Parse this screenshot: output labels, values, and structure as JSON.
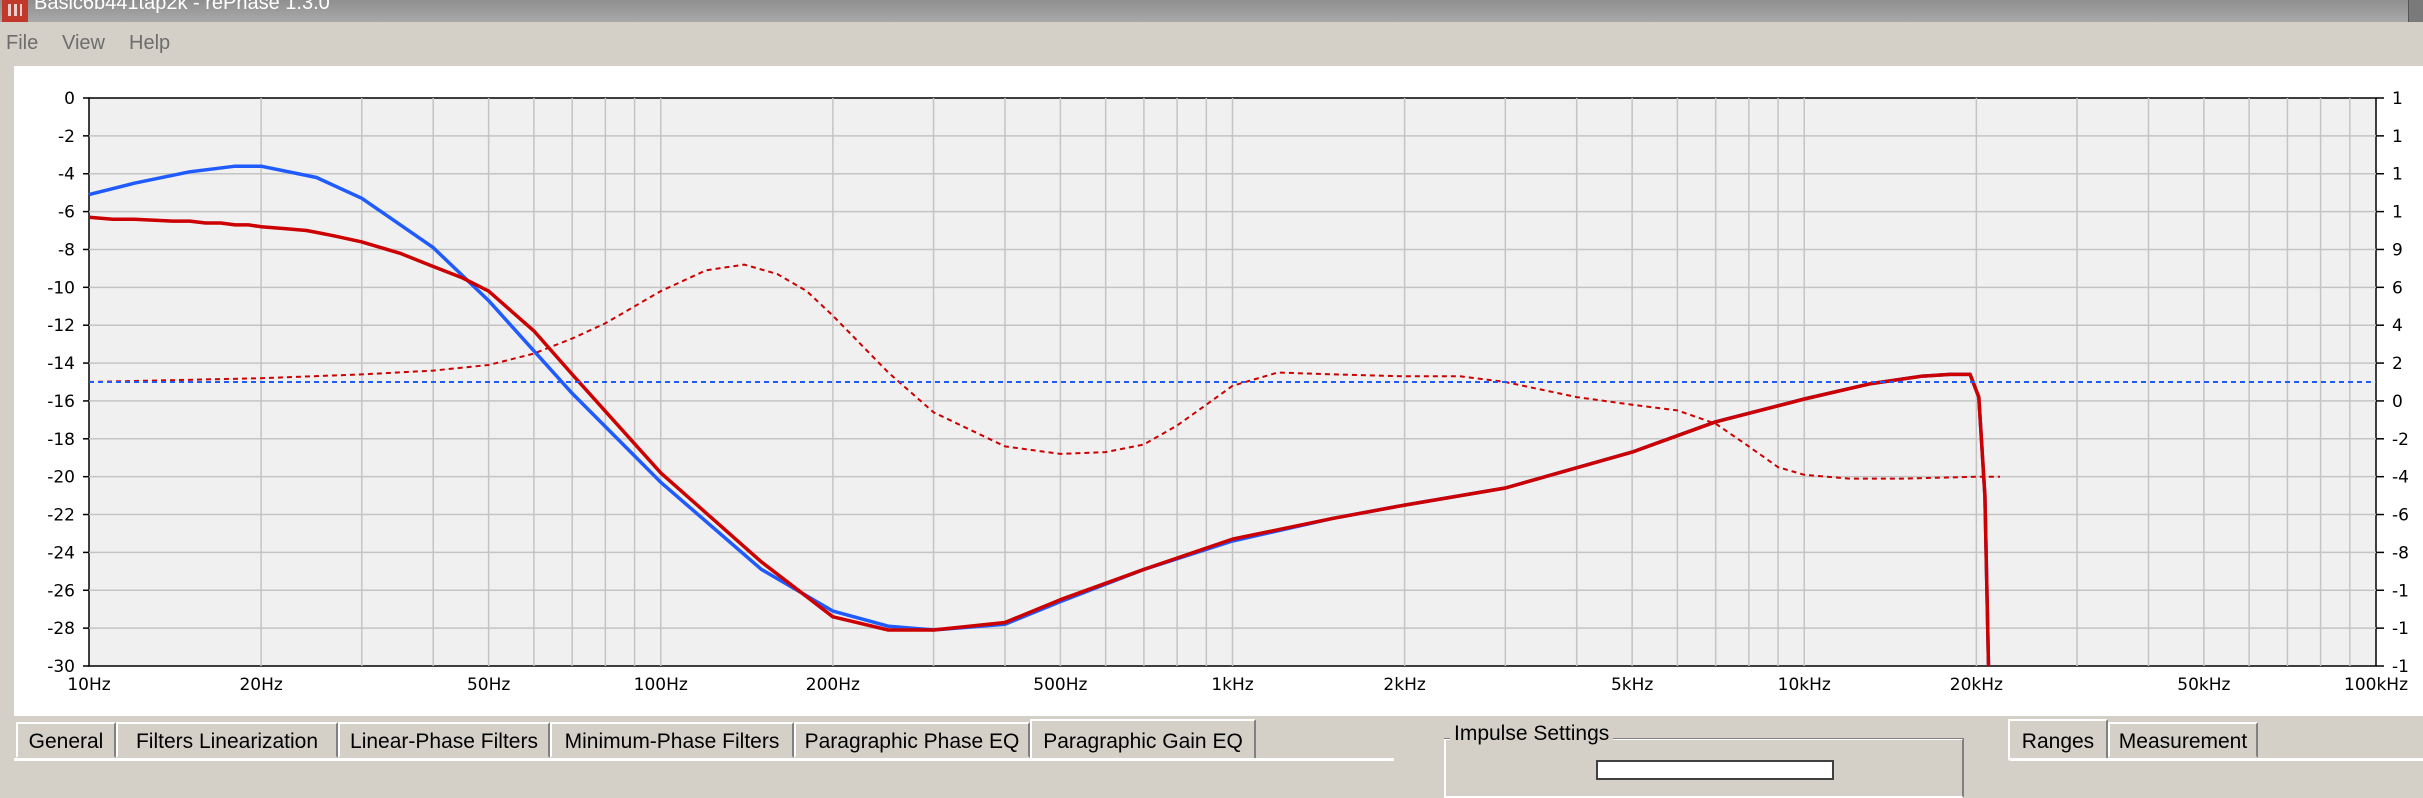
{
  "window": {
    "title": "Basic6b441tap2k  -  rePhase 1.3.0"
  },
  "menu": [
    "File",
    "View",
    "Help"
  ],
  "chart_data": {
    "type": "line",
    "title": "",
    "xlabel": "",
    "ylabel": "",
    "x_scale": "log",
    "xlim": [
      10,
      100000
    ],
    "ylim": [
      -30,
      0
    ],
    "x_ticks": [
      "10Hz",
      "20Hz",
      "50Hz",
      "100Hz",
      "200Hz",
      "500Hz",
      "1kHz",
      "2kHz",
      "5kHz",
      "10kHz",
      "20kHz",
      "50kHz",
      "100kHz"
    ],
    "x_tick_values": [
      10,
      20,
      50,
      100,
      200,
      500,
      1000,
      2000,
      5000,
      10000,
      20000,
      50000,
      100000
    ],
    "y_ticks": [
      0,
      -2,
      -4,
      -6,
      -8,
      -10,
      -12,
      -14,
      -16,
      -18,
      -20,
      -22,
      -24,
      -26,
      -28,
      -30
    ],
    "grid": true,
    "series": [
      {
        "color": "#1f5bff",
        "style": "solid",
        "x": [
          10,
          12,
          15,
          18,
          20,
          25,
          30,
          40,
          50,
          70,
          100,
          150,
          200,
          250,
          300,
          400,
          500,
          700,
          1000,
          1500,
          2000,
          3000,
          5000,
          7000,
          10000,
          13000,
          16000,
          18000,
          19500,
          20200,
          20700,
          21000
        ],
        "y": [
          -5.1,
          -4.5,
          -3.9,
          -3.6,
          -3.6,
          -4.2,
          -5.3,
          -7.9,
          -10.7,
          -15.6,
          -20.3,
          -24.9,
          -27.1,
          -27.9,
          -28.1,
          -27.8,
          -26.6,
          -24.9,
          -23.4,
          -22.2,
          -21.5,
          -20.6,
          -18.7,
          -17.1,
          -15.9,
          -15.1,
          -14.7,
          -14.6,
          -14.6,
          -15.8,
          -21,
          -30
        ]
      },
      {
        "color": "#cc0000",
        "style": "solid",
        "x": [
          10,
          11,
          12,
          14,
          15,
          16,
          17,
          18,
          19,
          20,
          22,
          24,
          25,
          27,
          30,
          35,
          40,
          45,
          50,
          60,
          70,
          100,
          150,
          200,
          250,
          300,
          400,
          500,
          700,
          1000,
          1500,
          2000,
          3000,
          5000,
          7000,
          10000,
          13000,
          16000,
          18000,
          19500,
          20200,
          20700,
          21000
        ],
        "y": [
          -6.3,
          -6.4,
          -6.4,
          -6.5,
          -6.5,
          -6.6,
          -6.6,
          -6.7,
          -6.7,
          -6.8,
          -6.9,
          -7.0,
          -7.1,
          -7.3,
          -7.6,
          -8.2,
          -8.9,
          -9.5,
          -10.2,
          -12.3,
          -14.6,
          -19.8,
          -24.5,
          -27.4,
          -28.1,
          -28.1,
          -27.7,
          -26.5,
          -24.9,
          -23.3,
          -22.2,
          -21.5,
          -20.6,
          -18.7,
          -17.1,
          -15.9,
          -15.1,
          -14.7,
          -14.6,
          -14.6,
          -15.8,
          -21,
          -30
        ]
      },
      {
        "color": "#cc0000",
        "style": "dashed",
        "x": [
          10,
          20,
          30,
          40,
          50,
          60,
          70,
          80,
          100,
          120,
          140,
          160,
          180,
          200,
          250,
          300,
          400,
          500,
          600,
          700,
          800,
          900,
          1000,
          1200,
          1500,
          2000,
          2500,
          3000,
          4000,
          5000,
          6000,
          7000,
          8000,
          9000,
          10000,
          12000,
          15000,
          20000,
          22000
        ],
        "y": [
          -15,
          -14.8,
          -14.6,
          -14.4,
          -14.1,
          -13.5,
          -12.7,
          -11.9,
          -10.2,
          -9.1,
          -8.8,
          -9.3,
          -10.2,
          -11.5,
          -14.5,
          -16.6,
          -18.4,
          -18.8,
          -18.7,
          -18.3,
          -17.3,
          -16.2,
          -15.2,
          -14.5,
          -14.6,
          -14.7,
          -14.7,
          -15.0,
          -15.8,
          -16.2,
          -16.5,
          -17.2,
          -18.4,
          -19.5,
          -19.9,
          -20.1,
          -20.1,
          -20.0,
          -20.0
        ]
      },
      {
        "color": "#1f5bff",
        "style": "dashed",
        "x": [
          10,
          100000
        ],
        "y": [
          -15,
          -15
        ]
      }
    ],
    "right_axis_labels": [
      "1",
      "1",
      "1",
      "1",
      "9",
      "6",
      "4",
      "2",
      "0",
      "-2",
      "-4",
      "-6",
      "-8",
      "-1",
      "-1",
      "-1"
    ]
  },
  "tabs": [
    "General",
    "Filters Linearization",
    "Linear-Phase Filters",
    "Minimum-Phase Filters",
    "Paragraphic Phase EQ",
    "Paragraphic Gain EQ"
  ],
  "active_tab": "Paragraphic Gain EQ",
  "impulse_settings": {
    "label": "Impulse Settings"
  },
  "right_tabs": [
    "Ranges",
    "Measurement"
  ]
}
